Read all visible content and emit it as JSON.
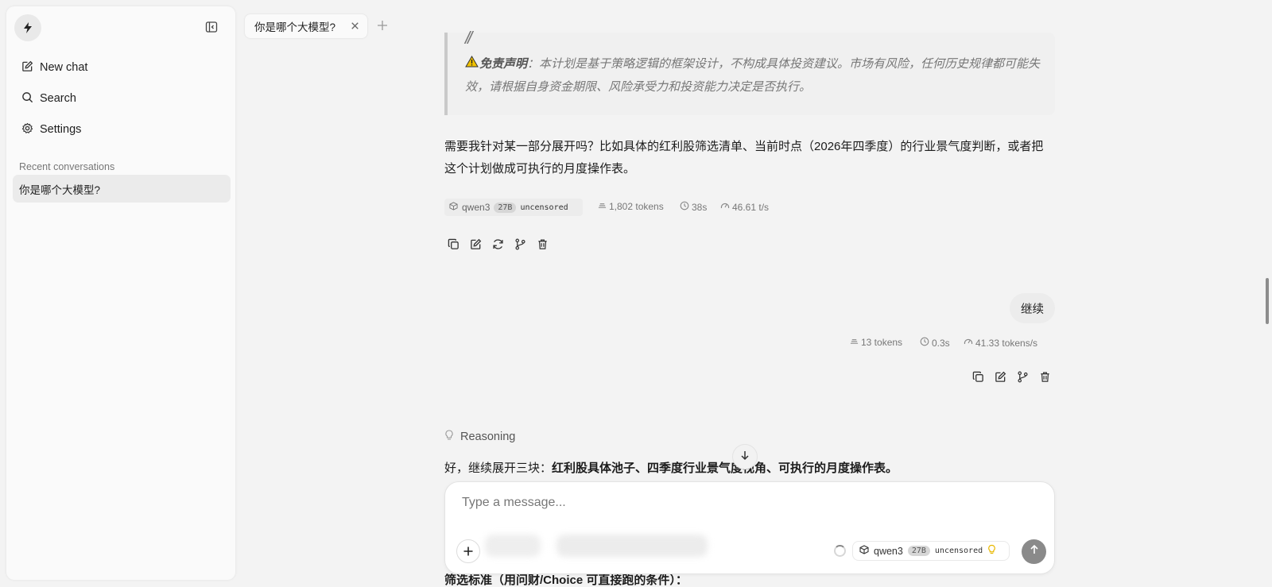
{
  "sidebar": {
    "nav": {
      "new_chat": "New chat",
      "search": "Search",
      "settings": "Settings"
    },
    "recent_label": "Recent conversations",
    "conversations": [
      "你是哪个大模型?"
    ]
  },
  "tabs": [
    {
      "label": "你是哪个大模型?"
    }
  ],
  "chat": {
    "disclaimer": {
      "label": "免责声明",
      "text": "：本计划是基于策略逻辑的框架设计，不构成具体投资建议。市场有风险，任何历史规律都可能失效，请根据自身资金期限、风险承受力和投资能力决定是否执行。"
    },
    "follow_up": "需要我针对某一部分展开吗？比如具体的红利股筛选清单、当前时点（2026年四季度）的行业景气度判断，或者把这个计划做成可执行的月度操作表。",
    "assistant_meta": {
      "model": "qwen3",
      "size_tag": "27B",
      "variant_tag": "uncensored",
      "tokens": "1,802 tokens",
      "time": "38s",
      "speed": "46.61 t/s"
    },
    "user_message": "继续",
    "user_meta": {
      "tokens": "13 tokens",
      "time": "0.3s",
      "speed": "41.33 tokens/s"
    },
    "reasoning_label": "Reasoning",
    "reply_prefix": "好，继续展开三块：",
    "reply_bold": "红利股具体池子、四季度行业景气度视角、可执行的月度操作表。",
    "partial_next": "筛选标准（用问财/Choice 可直接跑的条件）："
  },
  "composer": {
    "placeholder": "Type a message...",
    "model": "qwen3",
    "size_tag": "27B",
    "variant_tag": "uncensored"
  },
  "icons": {
    "logo": "bolt-logo-icon",
    "warning": "warning-icon"
  },
  "colors": {
    "accent": "#8a8a8a",
    "warning": "#f2c200",
    "bulb": "#e9b800"
  }
}
